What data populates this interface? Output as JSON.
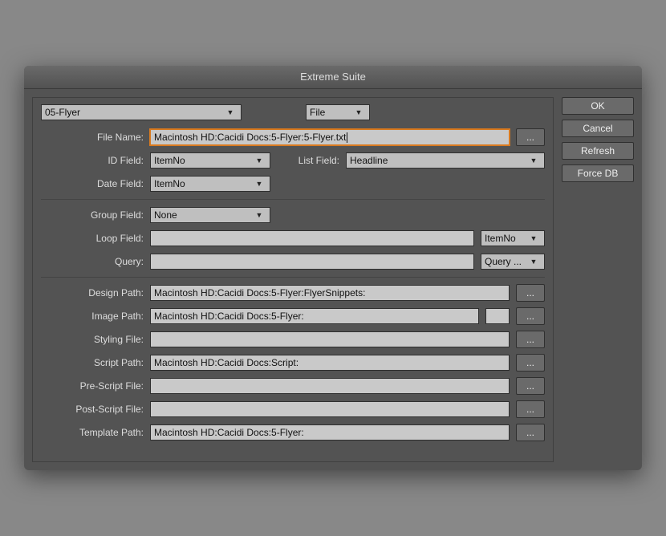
{
  "window": {
    "title": "Extreme Suite"
  },
  "top": {
    "preset": "05-Flyer",
    "mode": "File"
  },
  "fields": {
    "fileName": {
      "label": "File Name:",
      "value": "Macintosh HD:Cacidi Docs:5-Flyer:5-Flyer.txt",
      "browse": "..."
    },
    "idField": {
      "label": "ID Field:",
      "value": "ItemNo"
    },
    "listField": {
      "label": "List Field:",
      "value": "Headline"
    },
    "dateField": {
      "label": "Date Field:",
      "value": "ItemNo"
    },
    "groupField": {
      "label": "Group Field:",
      "value": "None"
    },
    "loopField": {
      "label": "Loop Field:",
      "value": "",
      "selector": "ItemNo"
    },
    "query": {
      "label": "Query:",
      "value": "",
      "selector": "Query ..."
    },
    "designPath": {
      "label": "Design Path:",
      "value": "Macintosh HD:Cacidi Docs:5-Flyer:FlyerSnippets:",
      "browse": "..."
    },
    "imagePath": {
      "label": "Image Path:",
      "value": "Macintosh HD:Cacidi Docs:5-Flyer:",
      "browse": "..."
    },
    "stylingFile": {
      "label": "Styling File:",
      "value": "",
      "browse": "..."
    },
    "scriptPath": {
      "label": "Script Path:",
      "value": "Macintosh HD:Cacidi Docs:Script:",
      "browse": "..."
    },
    "preScriptFile": {
      "label": "Pre-Script File:",
      "value": "",
      "browse": "..."
    },
    "postScriptFile": {
      "label": "Post-Script File:",
      "value": "",
      "browse": "..."
    },
    "templatePath": {
      "label": "Template Path:",
      "value": "Macintosh HD:Cacidi Docs:5-Flyer:",
      "browse": "..."
    }
  },
  "side": {
    "ok": "OK",
    "cancel": "Cancel",
    "refresh": "Refresh",
    "forceDB": "Force DB"
  }
}
